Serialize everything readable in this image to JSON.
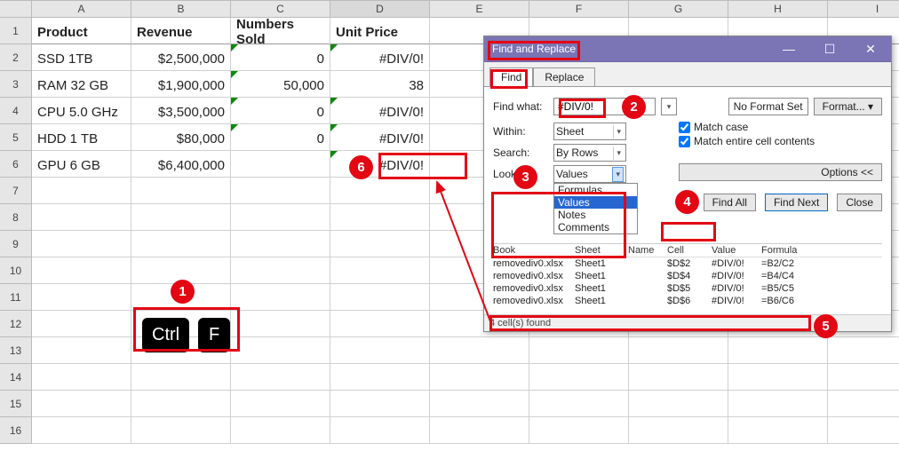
{
  "columns": [
    "A",
    "B",
    "C",
    "D",
    "E",
    "F",
    "G",
    "H",
    "I"
  ],
  "rows": 16,
  "header": {
    "A": "Product",
    "B": "Revenue",
    "C": "Numbers Sold",
    "D": "Unit Price"
  },
  "data": {
    "2": {
      "A": "SSD 1TB",
      "B": "$2,500,000",
      "C": "0",
      "D": "#DIV/0!"
    },
    "3": {
      "A": "RAM 32 GB",
      "B": "$1,900,000",
      "C": "50,000",
      "D": "38"
    },
    "4": {
      "A": "CPU 5.0 GHz",
      "B": "$3,500,000",
      "C": "0",
      "D": "#DIV/0!"
    },
    "5": {
      "A": "HDD 1 TB",
      "B": "$80,000",
      "C": "0",
      "D": "#DIV/0!"
    },
    "6": {
      "A": "GPU 6 GB",
      "B": "$6,400,000",
      "C": "",
      "D": "#DIV/0!"
    }
  },
  "keys": {
    "ctrl": "Ctrl",
    "f": "F"
  },
  "dlg": {
    "title": "Find and Replace",
    "tabs": {
      "find": "Find",
      "replace": "Replace"
    },
    "find_what_label": "Find what:",
    "find_what_value": "#DIV/0!",
    "no_format": "No Format Set",
    "format_btn": "Format...",
    "within_label": "Within:",
    "within_value": "Sheet",
    "search_label": "Search:",
    "search_value": "By Rows",
    "lookin_label": "Look in:",
    "lookin_value": "Values",
    "lookin_opts": [
      "Formulas",
      "Values",
      "Notes",
      "Comments"
    ],
    "match_case": "Match case",
    "match_entire": "Match entire cell contents",
    "options_btn": "Options <<",
    "find_all": "Find All",
    "find_next": "Find Next",
    "close": "Close",
    "cols": {
      "book": "Book",
      "sheet": "Sheet",
      "name": "Name",
      "cell": "Cell",
      "value": "Value",
      "formula": "Formula"
    },
    "results": [
      {
        "book": "removediv0.xlsx",
        "sheet": "Sheet1",
        "name": "",
        "cell": "$D$2",
        "value": "#DIV/0!",
        "formula": "=B2/C2"
      },
      {
        "book": "removediv0.xlsx",
        "sheet": "Sheet1",
        "name": "",
        "cell": "$D$4",
        "value": "#DIV/0!",
        "formula": "=B4/C4"
      },
      {
        "book": "removediv0.xlsx",
        "sheet": "Sheet1",
        "name": "",
        "cell": "$D$5",
        "value": "#DIV/0!",
        "formula": "=B5/C5"
      },
      {
        "book": "removediv0.xlsx",
        "sheet": "Sheet1",
        "name": "",
        "cell": "$D$6",
        "value": "#DIV/0!",
        "formula": "=B6/C6"
      }
    ],
    "status": "4 cell(s) found"
  }
}
